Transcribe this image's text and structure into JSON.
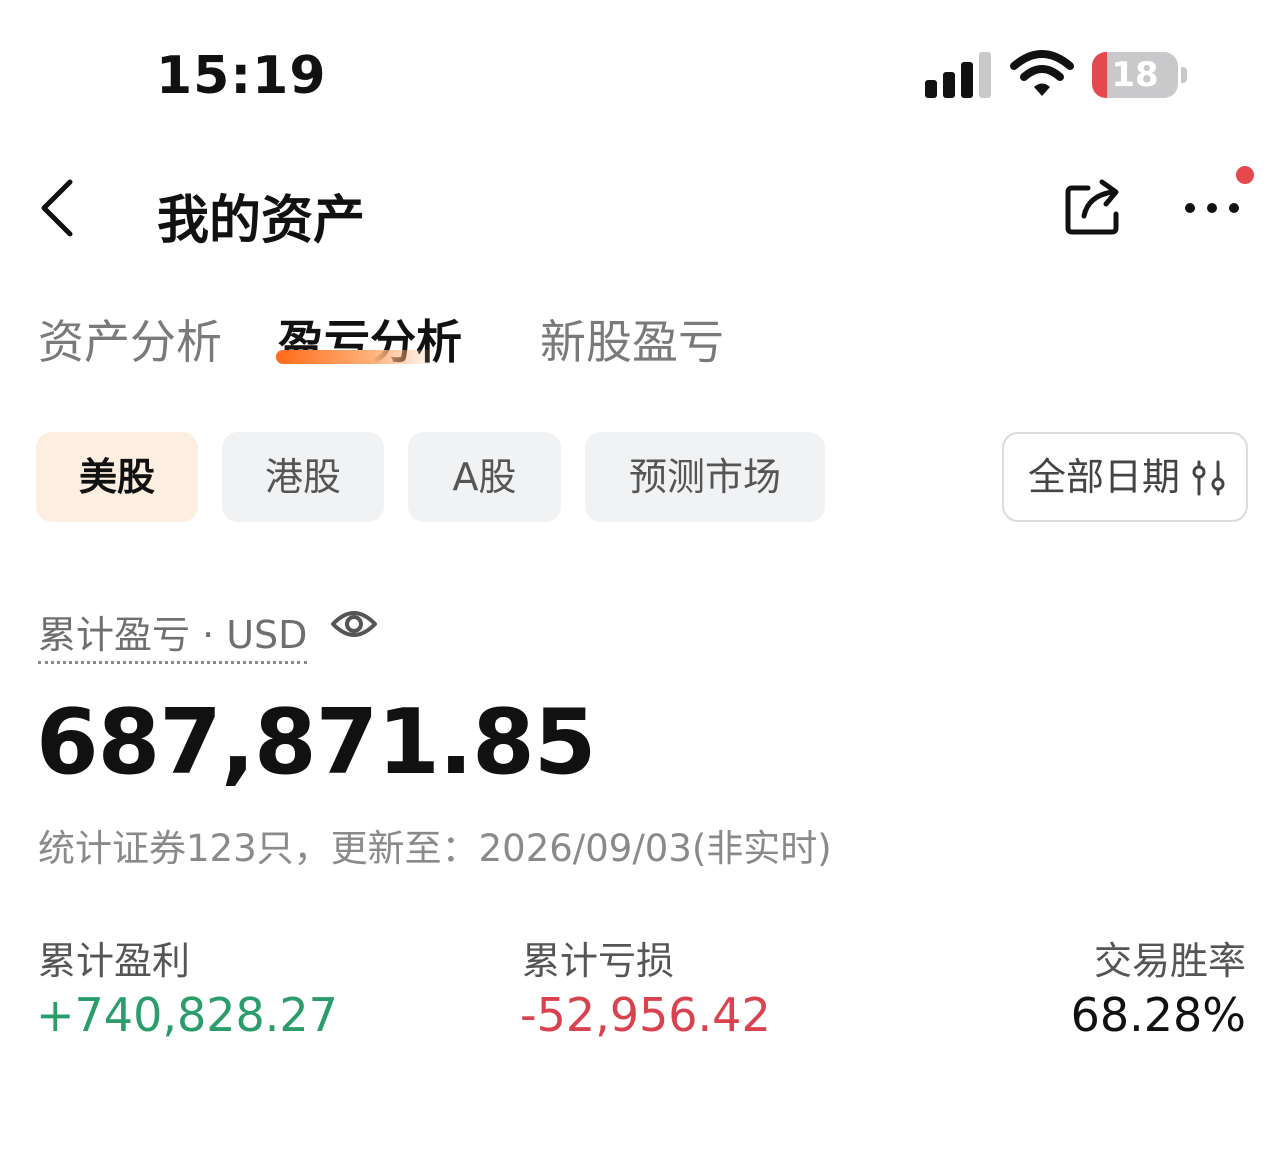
{
  "status_bar": {
    "time": "15:19",
    "battery_level": "18",
    "icons": [
      "signal-icon",
      "wifi-icon",
      "battery-icon"
    ]
  },
  "nav": {
    "title": "我的资产",
    "back_icon": "chevron-left-icon",
    "share_icon": "share-icon",
    "more_icon": "more-icon",
    "badge_color": "#e5484d"
  },
  "tabs": [
    {
      "label": "资产分析",
      "active": false
    },
    {
      "label": "盈亏分析",
      "active": true
    },
    {
      "label": "新股盈亏",
      "active": false
    }
  ],
  "markets": [
    {
      "label": "美股",
      "active": true
    },
    {
      "label": "港股",
      "active": false
    },
    {
      "label": "A股",
      "active": false
    },
    {
      "label": "预测市场",
      "active": false
    }
  ],
  "date_filter": {
    "label": "全部日期",
    "icon": "filter-sliders-icon"
  },
  "summary": {
    "label": "累计盈亏 · USD",
    "value": "687,871.85",
    "note": "统计证券123只，更新至：2026/09/03(非实时)",
    "eye_icon": "eye-icon"
  },
  "metrics": [
    {
      "label": "累计盈利",
      "value": "+740,828.27",
      "tone": "positive"
    },
    {
      "label": "累计亏损",
      "value": "-52,956.42",
      "tone": "negative"
    },
    {
      "label": "交易胜率",
      "value": "68.28%",
      "tone": "neutral"
    }
  ],
  "colors": {
    "positive": "#2a9d6b",
    "negative": "#d9434f",
    "accent": "#ff6a1a",
    "chip_active_bg": "#fdeee2"
  }
}
